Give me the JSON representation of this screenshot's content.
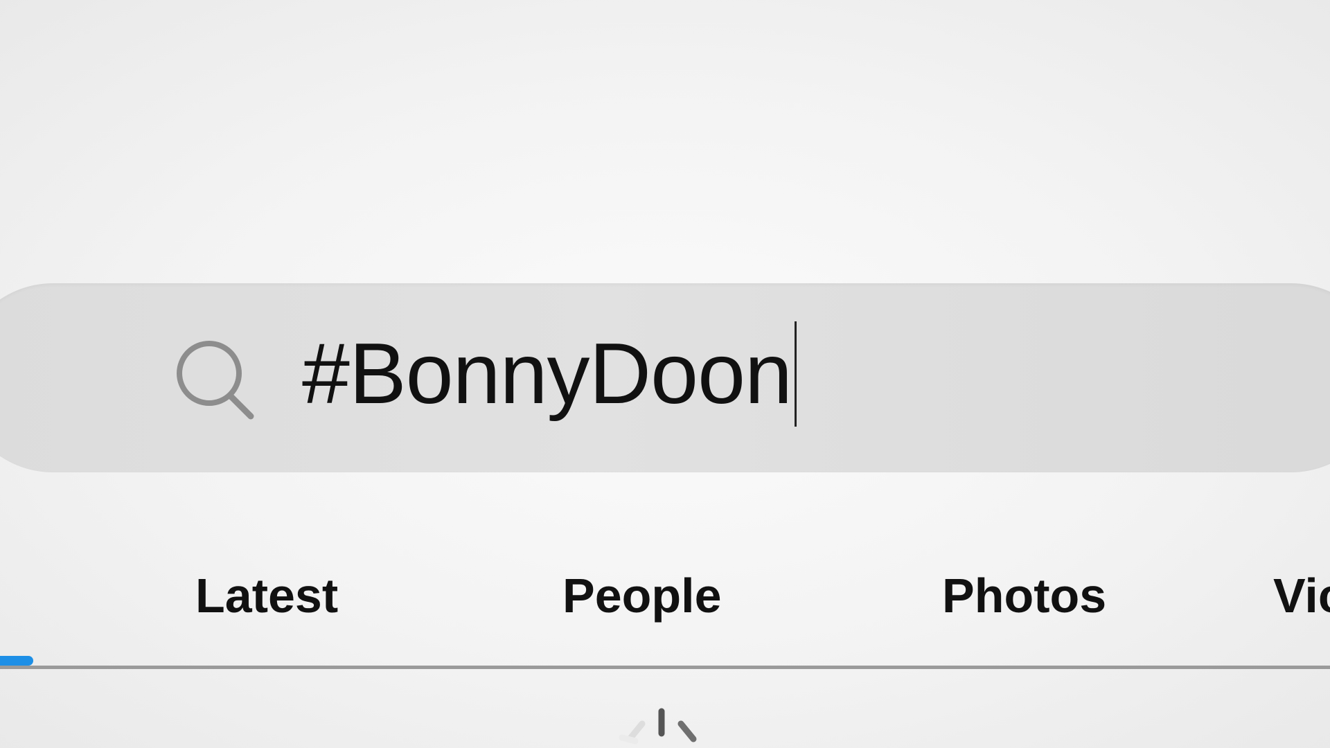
{
  "search": {
    "query": "#BonnyDoon",
    "icon": "search-icon"
  },
  "tabs": [
    {
      "label": "Latest"
    },
    {
      "label": "People"
    },
    {
      "label": "Photos"
    },
    {
      "label": "Vic"
    }
  ],
  "active_tab_color": "#1d8fe6",
  "loading_icon": "spinner-icon"
}
